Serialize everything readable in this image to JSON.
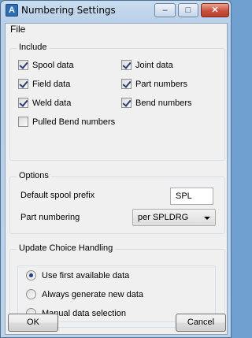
{
  "window": {
    "title": "Numbering Settings",
    "icon": "app-logo-icon",
    "controls": {
      "minimize": "–",
      "maximize": "□",
      "close": "✕"
    }
  },
  "menu": {
    "file": "File"
  },
  "include": {
    "legend": "Include",
    "items": [
      {
        "label": "Spool data",
        "checked": true
      },
      {
        "label": "Joint data",
        "checked": true
      },
      {
        "label": "Field data",
        "checked": true
      },
      {
        "label": "Part numbers",
        "checked": true
      },
      {
        "label": "Weld data",
        "checked": true
      },
      {
        "label": "Bend numbers",
        "checked": true
      },
      {
        "label": "Pulled Bend numbers",
        "checked": false
      }
    ]
  },
  "options": {
    "legend": "Options",
    "prefix_label": "Default spool prefix",
    "prefix_value": "SPL",
    "part_numbering_label": "Part numbering",
    "part_numbering_value": "per SPLDRG"
  },
  "update": {
    "legend": "Update Choice Handling",
    "options": [
      {
        "label": "Use first available data",
        "selected": true
      },
      {
        "label": "Always generate new data",
        "selected": false
      },
      {
        "label": "Manual data selection",
        "selected": false
      }
    ]
  },
  "buttons": {
    "ok": "OK",
    "cancel": "Cancel"
  }
}
